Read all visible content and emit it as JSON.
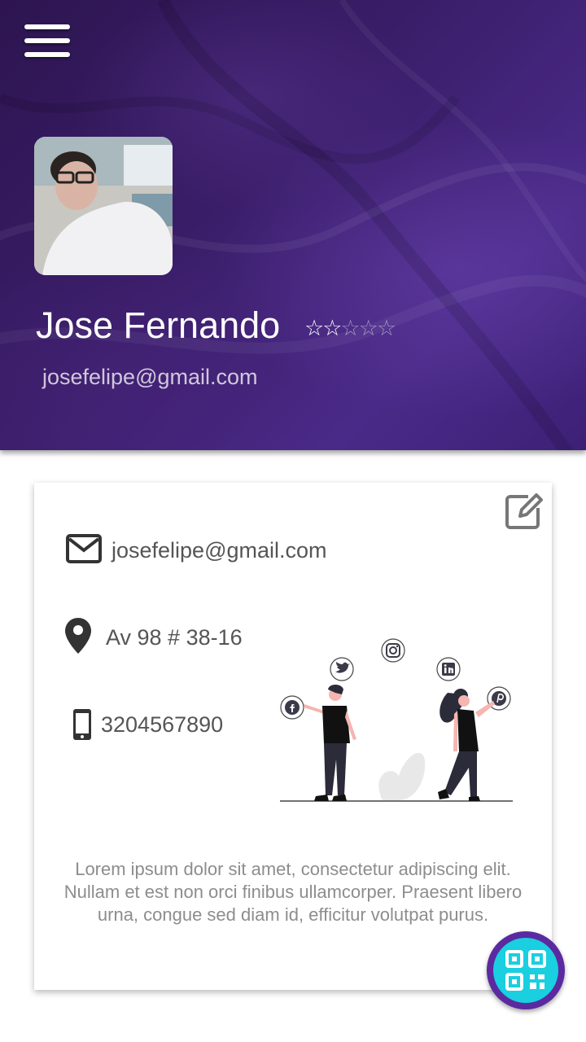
{
  "header": {
    "name": "Jose Fernando",
    "email": "josefelipe@gmail.com",
    "rating": {
      "value": 2,
      "max": 5
    }
  },
  "contact": {
    "email": "josefelipe@gmail.com",
    "address": "Av 98 # 38-16",
    "phone": "3204567890"
  },
  "description": "Lorem ipsum dolor sit amet, consectetur adipiscing elit. Nullam et est non orci finibus ullamcorper. Praesent libero urna, congue sed diam id, efficitur volutpat purus.",
  "icons": {
    "menu": "hamburger-menu-icon",
    "edit": "edit-icon",
    "email": "mail-icon",
    "location": "location-pin-icon",
    "phone": "phone-icon",
    "qr": "qr-code-icon"
  },
  "colors": {
    "header_purple": "#3a1d68",
    "fab_ring": "#5b2aa0",
    "fab_fill": "#19cfe0",
    "text_gray": "#555555"
  }
}
